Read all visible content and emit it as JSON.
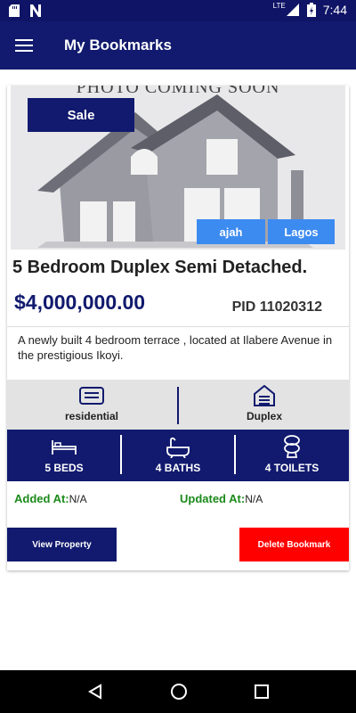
{
  "status_bar": {
    "network": "LTE",
    "time": "7:44"
  },
  "app_bar": {
    "title": "My Bookmarks"
  },
  "listing": {
    "photo_text": "PHOTO COMING SOON",
    "sale_badge": "Sale",
    "location_tags": [
      "ajah",
      "Lagos"
    ],
    "headline": "5 Bedroom Duplex Semi Detached.",
    "price": "$4,000,000.00",
    "pid": "PID 11020312",
    "description": "A newly built 4 bedroom terrace , located at Ilabere Avenue in the prestigious Ikoyi.",
    "property_category": "residential",
    "property_type": "Duplex",
    "beds": "5 BEDS",
    "baths": "4 BATHS",
    "toilets": "4 TOILETS",
    "added_label": "Added At:",
    "added_value": "N/A",
    "updated_label": "Updated At:",
    "updated_value": "N/A",
    "view_button": "View Property",
    "delete_button": "Delete Bookmark"
  },
  "colors": {
    "primary": "#111a6e",
    "location_tag": "#3c8bf0",
    "delete": "#ff0000",
    "label_green": "#1b8a1b"
  }
}
